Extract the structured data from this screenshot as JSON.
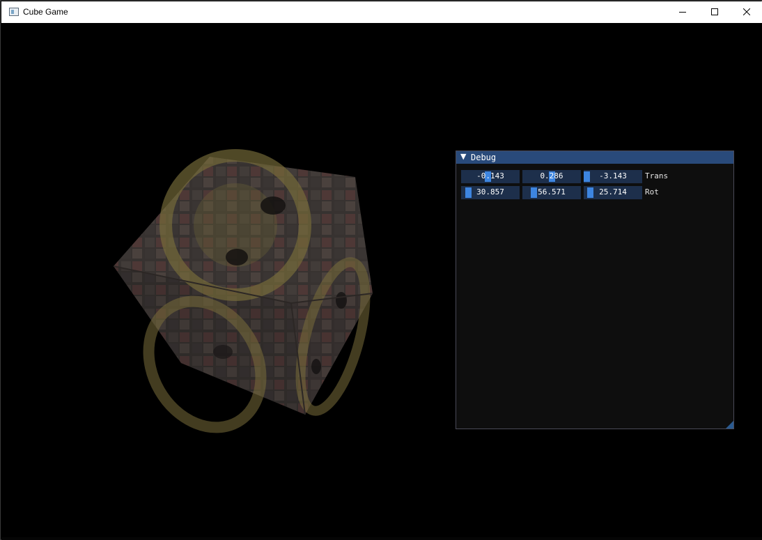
{
  "window": {
    "title": "Cube Game",
    "icon": "app-window-icon",
    "controls": {
      "minimize": "minimize-icon",
      "maximize": "maximize-icon",
      "close": "close-icon"
    }
  },
  "debug": {
    "title": "Debug",
    "collapse_icon": "collapse-triangle-icon",
    "accent": "#294a7a",
    "grab_color": "#3d85e0",
    "rows": [
      {
        "label": "Trans",
        "values": [
          "-0.143",
          "0.286",
          "-3.143"
        ],
        "levels": [
          0.45,
          0.5,
          0.0
        ]
      },
      {
        "label": "Rot",
        "values": [
          "30.857",
          "56.571",
          "25.714"
        ],
        "levels": [
          0.086,
          0.157,
          0.071
        ]
      }
    ]
  }
}
